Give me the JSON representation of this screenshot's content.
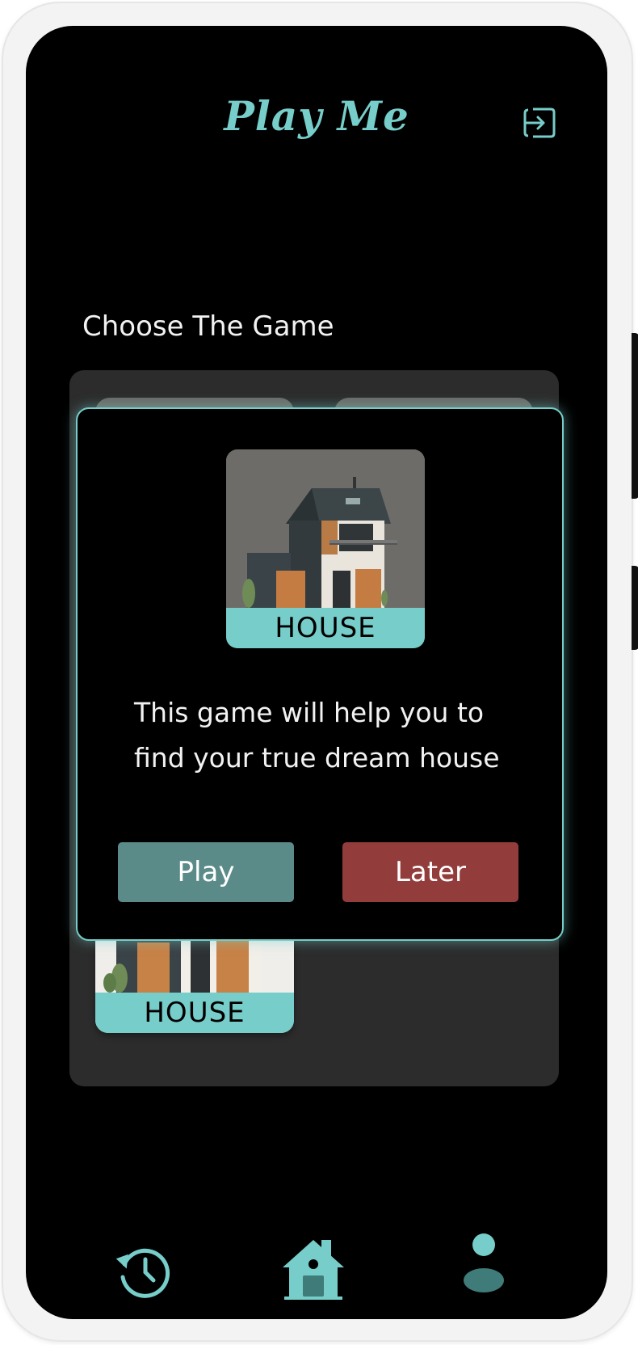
{
  "app": {
    "title": "Play Me"
  },
  "header": {
    "exit_icon": "exit-icon"
  },
  "main": {
    "section_title": "Choose The Game"
  },
  "games": [
    {
      "label": "HOUSE"
    }
  ],
  "modal": {
    "game_label": "HOUSE",
    "description_line1": "This game will help you to",
    "description_line2": "find your true dream house",
    "play_label": "Play",
    "later_label": "Later"
  },
  "nav": {
    "items": [
      {
        "icon": "history-icon"
      },
      {
        "icon": "home-icon"
      },
      {
        "icon": "profile-icon"
      }
    ]
  },
  "colors": {
    "accent": "#76cdc9",
    "background": "#000000",
    "panel": "#2c2c2c",
    "play_button": "#5a8b88",
    "later_button": "#933c3c"
  }
}
